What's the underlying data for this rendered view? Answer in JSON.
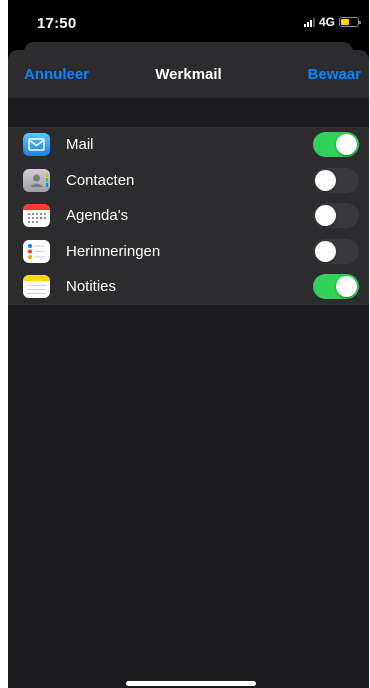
{
  "status_bar": {
    "time": "17:50",
    "network": "4G"
  },
  "nav": {
    "cancel_label": "Annuleer",
    "title": "Werkmail",
    "save_label": "Bewaar"
  },
  "items": [
    {
      "label": "Mail",
      "icon": "mail-icon",
      "enabled": true
    },
    {
      "label": "Contacten",
      "icon": "contacts-icon",
      "enabled": false
    },
    {
      "label": "Agenda's",
      "icon": "calendar-icon",
      "enabled": false
    },
    {
      "label": "Herinneringen",
      "icon": "reminders-icon",
      "enabled": false
    },
    {
      "label": "Notities",
      "icon": "notes-icon",
      "enabled": true
    }
  ],
  "colors": {
    "accent": "#0a84ff",
    "toggle_on": "#30d158",
    "toggle_off": "#39393d",
    "battery": "#ffd60a"
  }
}
